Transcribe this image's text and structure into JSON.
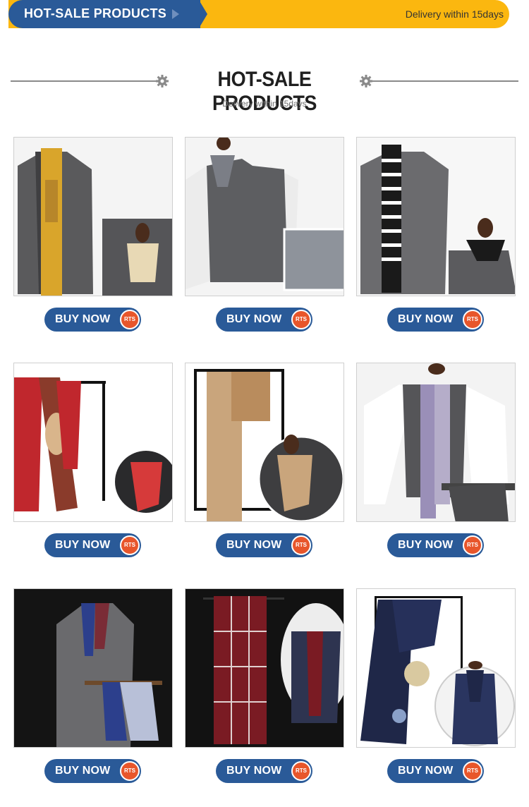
{
  "banner": {
    "title": "HOT-SALE PRODUCTS",
    "delivery": "Delivery within 15days",
    "colors": {
      "blue": "#2a5a98",
      "yellow": "#fbb70f"
    }
  },
  "section": {
    "title": "HOT-SALE PRODUCTS",
    "subtitle": "Delivery within 15days",
    "icon": "gear-icon"
  },
  "products": [
    {
      "id": "p1",
      "buy_label": "BUY NOW",
      "badge": "RTS",
      "scarf_color": "#d9a52b",
      "desc": "yellow-scarf-vest"
    },
    {
      "id": "p2",
      "buy_label": "BUY NOW",
      "badge": "RTS",
      "scarf_color": "#7b7e86",
      "desc": "grey-ascot-vest"
    },
    {
      "id": "p3",
      "buy_label": "BUY NOW",
      "badge": "RTS",
      "scarf_color": "#1a1a1a",
      "desc": "striped-scarf-vest"
    },
    {
      "id": "p4",
      "buy_label": "BUY NOW",
      "badge": "RTS",
      "scarf_color": "#c0272d",
      "desc": "red-paisley-scarf"
    },
    {
      "id": "p5",
      "buy_label": "BUY NOW",
      "badge": "RTS",
      "scarf_color": "#c9a57c",
      "desc": "beige-pattern-scarf"
    },
    {
      "id": "p6",
      "buy_label": "BUY NOW",
      "badge": "RTS",
      "scarf_color": "#9a8fb8",
      "desc": "paisley-scarf-vest"
    },
    {
      "id": "p7",
      "buy_label": "BUY NOW",
      "badge": "RTS",
      "scarf_color": "#2c3f8c",
      "desc": "blue-paisley-scarf-jacket"
    },
    {
      "id": "p8",
      "buy_label": "BUY NOW",
      "badge": "RTS",
      "scarf_color": "#7a1b23",
      "desc": "burgundy-check-scarf"
    },
    {
      "id": "p9",
      "buy_label": "BUY NOW",
      "badge": "RTS",
      "scarf_color": "#1f2748",
      "desc": "navy-paisley-scarf"
    }
  ],
  "badge_color": "#e8562b"
}
